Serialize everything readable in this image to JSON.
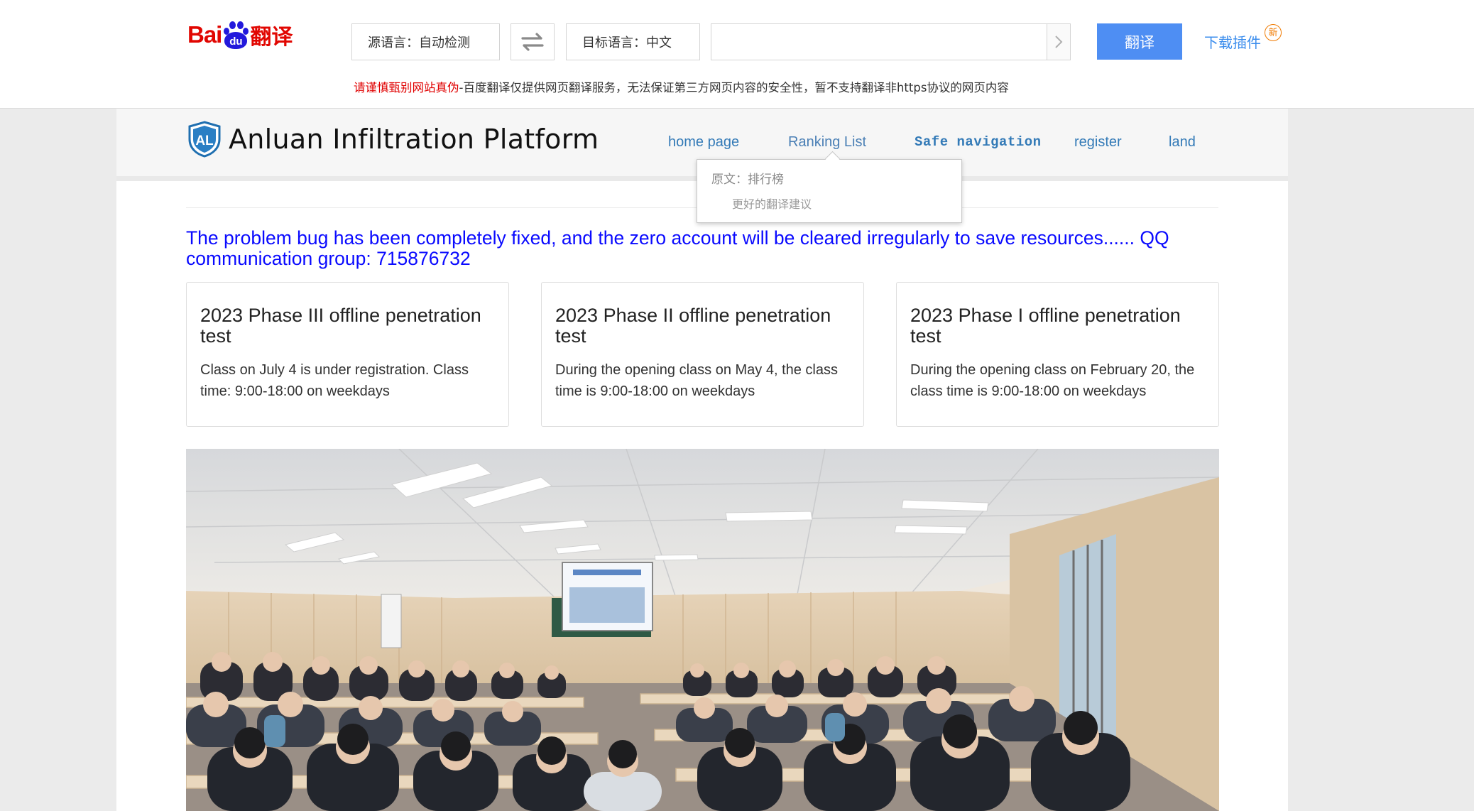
{
  "translate_bar": {
    "logo": {
      "text1": "Bai",
      "text2": "du",
      "text3": "翻译"
    },
    "source_lang_label": "源语言：自动检测",
    "target_lang_label": "目标语言：中文",
    "url_input": {
      "value": "",
      "placeholder": ""
    },
    "translate_button": "翻译",
    "download_plugin": "下载插件",
    "new_badge": "新",
    "notice_warning": "请谨慎甄别网站真伪",
    "notice_text": "-百度翻译仅提供网页翻译服务，无法保证第三方网页内容的安全性，暂不支持翻译非https协议的网页内容"
  },
  "site": {
    "title": "Anluan Infiltration Platform",
    "logo_text": "AL",
    "nav": [
      "home page",
      "Ranking List",
      "Safe navigation",
      "register",
      "land"
    ],
    "tooltip": {
      "original": "原文：排行榜",
      "better": "更好的翻译建议"
    },
    "announcement": "The problem bug has been completely fixed, and the zero account will be cleared irregularly to save resources...... QQ communication group: 715876732",
    "cards": [
      {
        "title": "2023 Phase III offline penetration test",
        "body": "Class on July 4 is under registration. Class time: 9:00-18:00 on weekdays"
      },
      {
        "title": "2023 Phase II offline penetration test",
        "body": "During the opening class on May 4, the class time is 9:00-18:00 on weekdays"
      },
      {
        "title": "2023 Phase I offline penetration test",
        "body": "During the opening class on February 20, the class time is 9:00-18:00 on weekdays"
      }
    ]
  },
  "colors": {
    "baidu_red": "#e10601",
    "baidu_blue": "#2319dc",
    "translate_button": "#4e8ef3",
    "link_blue": "#337ab7",
    "announcement_blue": "#0a0aff"
  }
}
